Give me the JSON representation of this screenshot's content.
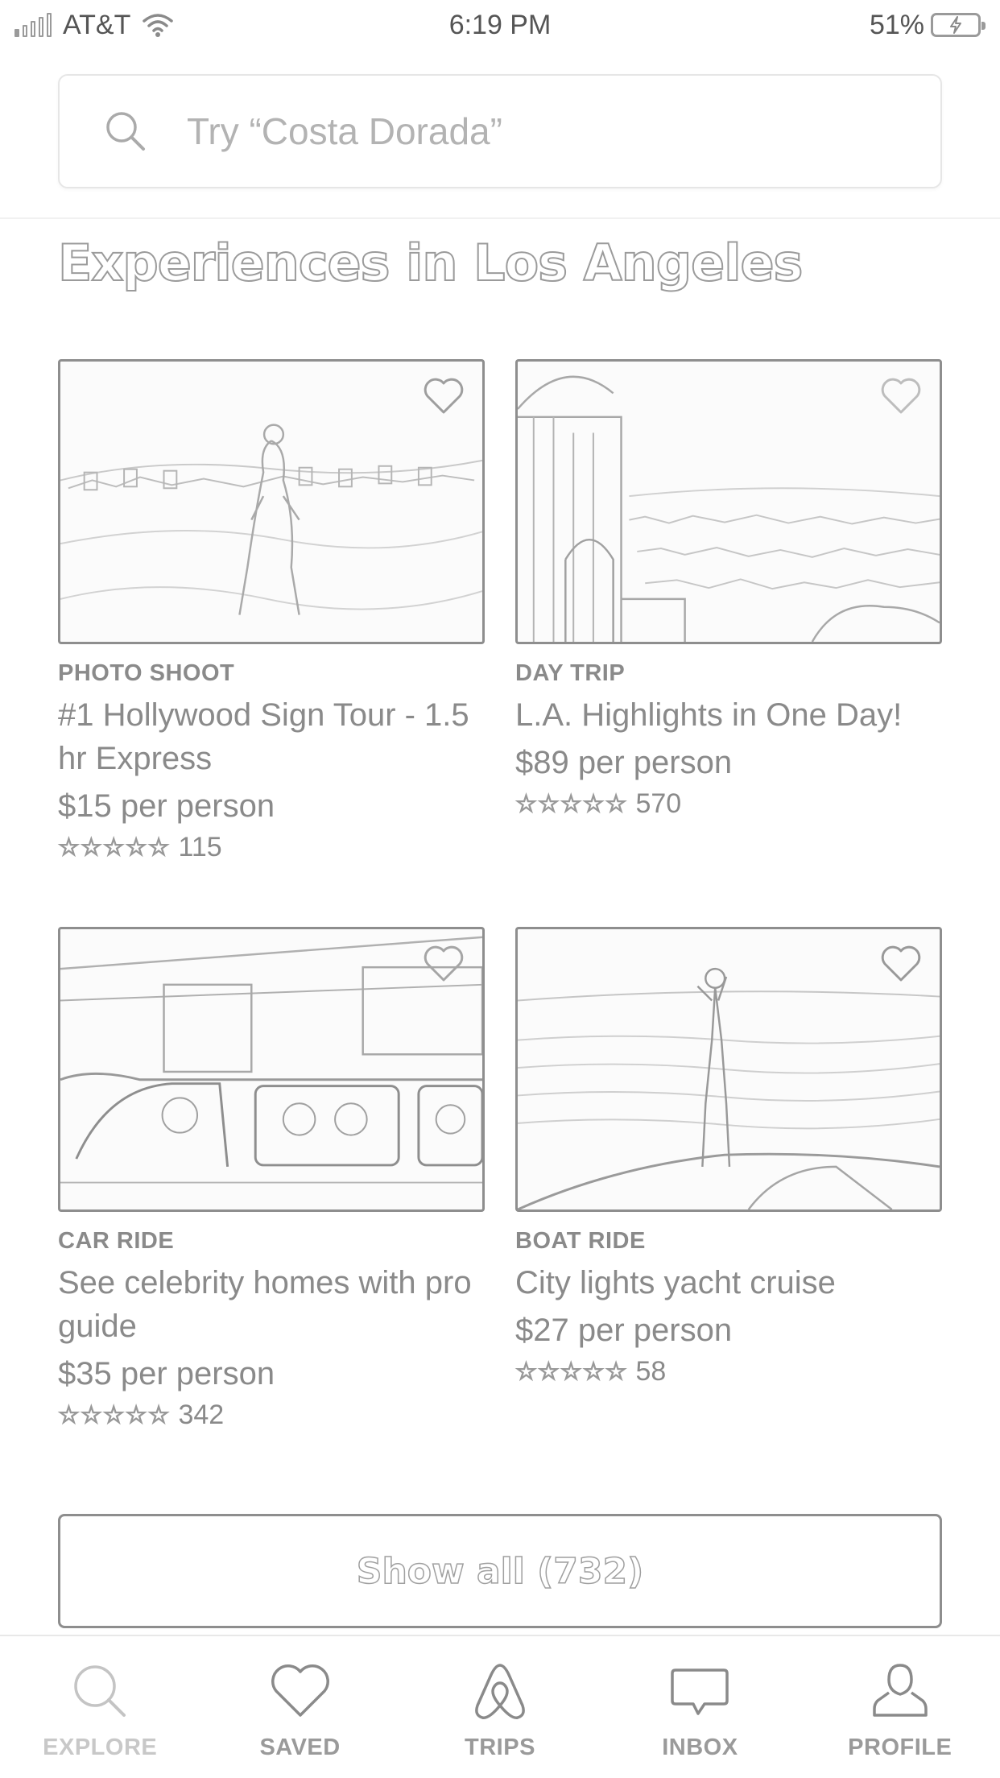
{
  "status_bar": {
    "carrier": "AT&T",
    "time": "6:19 PM",
    "battery": "51%"
  },
  "search": {
    "placeholder": "Try “Costa Dorada”"
  },
  "section": {
    "title": "Experiences in Los Angeles"
  },
  "experiences": [
    {
      "category": "PHOTO SHOOT",
      "title": "#1 Hollywood Sign Tour - 1.5 hr Express",
      "price": "$15 per person",
      "stars": "☆☆☆☆☆",
      "reviews": "115",
      "image": "hollywood-sign-photo"
    },
    {
      "category": "DAY TRIP",
      "title": "L.A. Highlights in One Day!",
      "price": "$89 per person",
      "stars": "☆☆☆☆☆",
      "reviews": "570",
      "image": "observatory-city-view-photo"
    },
    {
      "category": "CAR RIDE",
      "title": "See celebrity homes with pro guide",
      "price": "$35 per person",
      "stars": "☆☆☆☆☆",
      "reviews": "342",
      "image": "tour-van-photo"
    },
    {
      "category": "BOAT RIDE",
      "title": "City lights yacht cruise",
      "price": "$27 per person",
      "stars": "☆☆☆☆☆",
      "reviews": "58",
      "image": "yacht-ocean-photo"
    }
  ],
  "show_all": {
    "label": "Show all (732)"
  },
  "bottom_nav": [
    {
      "label": "EXPLORE",
      "icon": "search-icon",
      "active": true
    },
    {
      "label": "SAVED",
      "icon": "heart-icon",
      "active": false
    },
    {
      "label": "TRIPS",
      "icon": "airbnb-logo-icon",
      "active": false
    },
    {
      "label": "INBOX",
      "icon": "chat-bubble-icon",
      "active": false
    },
    {
      "label": "PROFILE",
      "icon": "person-icon",
      "active": false
    }
  ]
}
